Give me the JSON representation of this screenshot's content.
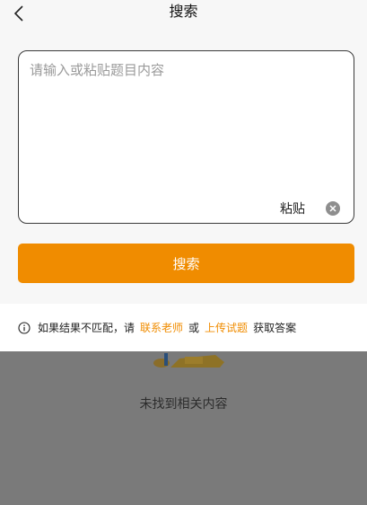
{
  "nav": {
    "title": "搜索"
  },
  "search": {
    "placeholder": "请输入或粘贴题目内容",
    "paste_label": "粘贴",
    "button_label": "搜索"
  },
  "notice": {
    "prefix": "如果结果不匹配，请",
    "contact_link": "联系老师",
    "or": "或",
    "upload_link": "上传试题",
    "suffix": "获取答案"
  },
  "empty": {
    "text": "未找到相关内容"
  },
  "colors": {
    "accent": "#f08c00",
    "overlay": "#7a7a7a"
  },
  "icons": [
    "back-arrow-icon",
    "clear-icon",
    "info-icon",
    "empty-illustration"
  ]
}
